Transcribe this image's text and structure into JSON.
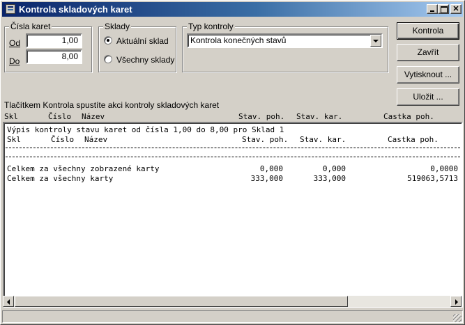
{
  "window": {
    "title": "Kontrola skladových karet"
  },
  "cards": {
    "group_label": "Čísla karet",
    "from_label": "Od",
    "from_value": "1,00",
    "to_label": "Do",
    "to_value": "8,00"
  },
  "warehouses": {
    "group_label": "Sklady",
    "options": [
      {
        "label": "Aktuální sklad",
        "checked": true
      },
      {
        "label": "Všechny sklady",
        "checked": false
      }
    ]
  },
  "check_type": {
    "group_label": "Typ kontroly",
    "selected": "Kontrola konečných stavů"
  },
  "buttons": {
    "check": "Kontrola",
    "close": "Zavřít",
    "print": "Vytisknout ...",
    "save": "Uložit ..."
  },
  "hint": "Tlačítkem Kontrola spustíte akci kontroly skladových karet",
  "columns": [
    "Skl",
    "Číslo",
    "Název",
    "Stav. poh.",
    "Stav. kar.",
    "Castka poh."
  ],
  "report": {
    "header": "Výpis kontroly stavu karet od čísla 1,00 do 8,00 pro Sklad 1",
    "columns": [
      "Skl",
      "Číslo",
      "Název",
      "Stav. poh.",
      "Stav. kar.",
      "Castka poh."
    ],
    "rows": [
      {
        "label": "Celkem za všechny zobrazené karty",
        "stav_poh": "0,000",
        "stav_kar": "0,000",
        "castka": "0,0000"
      },
      {
        "label": "Celkem za všechny karty",
        "stav_poh": "333,000",
        "stav_kar": "333,000",
        "castka": "519063,5713"
      }
    ]
  }
}
